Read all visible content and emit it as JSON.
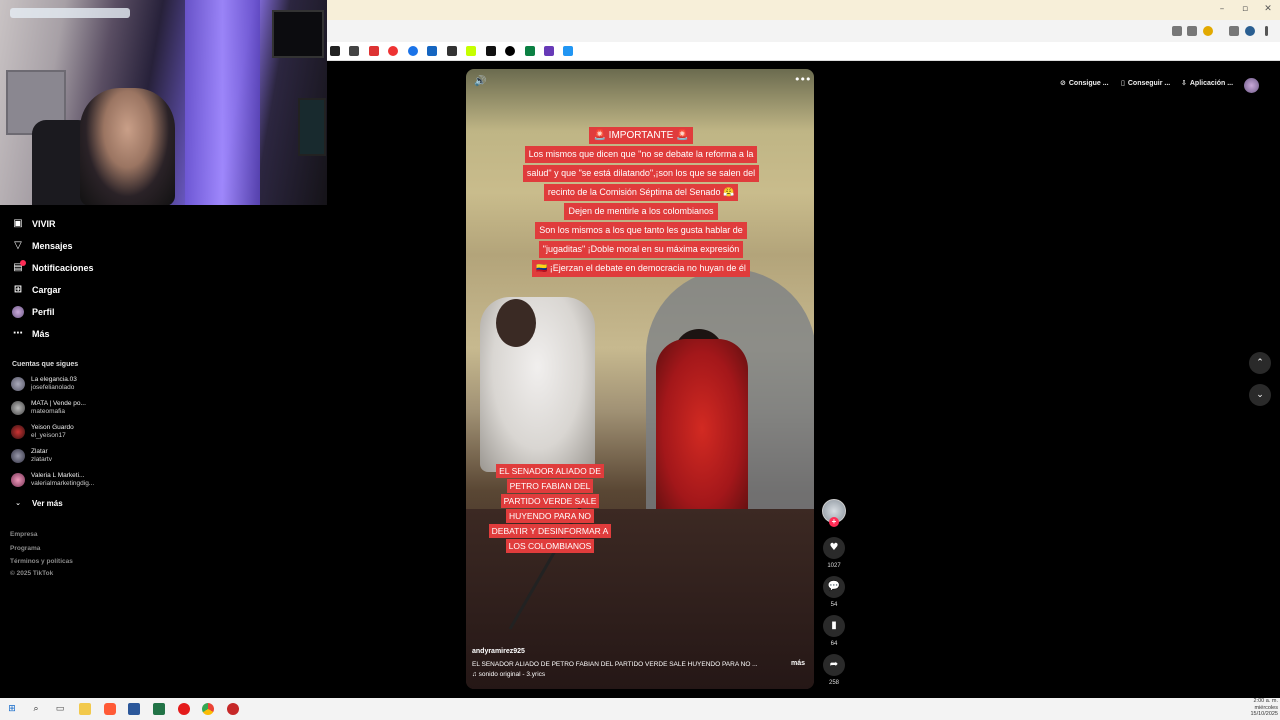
{
  "browser": {
    "window_controls": [
      "–",
      "▫",
      "✕"
    ]
  },
  "sidebar": {
    "nav": [
      {
        "label": "VIVIR",
        "icon": "live-icon"
      },
      {
        "label": "Mensajes",
        "icon": "messages-icon"
      },
      {
        "label": "Notificaciones",
        "icon": "notifications-icon"
      },
      {
        "label": "Cargar",
        "icon": "upload-icon"
      },
      {
        "label": "Perfil",
        "icon": "profile-icon"
      },
      {
        "label": "Más",
        "icon": "more-icon"
      }
    ],
    "following_title": "Cuentas que sigues",
    "following": [
      {
        "name": "La elegancia.03",
        "handle": "josefelianolado"
      },
      {
        "name": "MATA | Vende po...",
        "handle": "mateomafia"
      },
      {
        "name": "Yeison Guardo",
        "handle": "el_yeison17"
      },
      {
        "name": "Zlatar",
        "handle": "zlatartv"
      },
      {
        "name": "Valeria L Marketi...",
        "handle": "valerialmarketingdig..."
      }
    ],
    "see_more": "Ver más",
    "footer": [
      "Empresa",
      "Programa",
      "Términos y políticas",
      "© 2025 TikTok"
    ]
  },
  "header": {
    "buttons": [
      "Consigue ...",
      "Conseguir ...",
      "Aplicación ..."
    ]
  },
  "video": {
    "caption_top": [
      "🚨 IMPORTANTE 🚨",
      "Los mismos que dicen que \"no se debate la reforma a la",
      "salud\" y que \"se está dilatando\",¡son los que se salen del",
      "recinto de la Comisión Séptima del Senado 😤",
      "Dejen de mentirle a los colombianos",
      "Son los mismos a los que tanto les gusta hablar de",
      "\"jugaditas\" ¡Doble moral en su máxima expresión",
      "🇨🇴 ¡Ejerzan el debate en democracia no huyan de él"
    ],
    "caption_bottom": [
      "EL SENADOR ALIADO DE",
      "PETRO FABIAN DEL",
      "PARTIDO VERDE SALE",
      "HUYENDO PARA NO",
      "DEBATIR Y DESINFORMAR A",
      "LOS COLOMBIANOS"
    ],
    "author": "andyramirez925",
    "description": "EL SENADOR ALIADO DE PETRO FABIAN DEL PARTIDO VERDE SALE HUYENDO PARA NO ...",
    "more_label": "más",
    "sound": "♫ sonido original - 3.yrics"
  },
  "actions": {
    "likes": "1027",
    "comments": "54",
    "saves": "64",
    "shares": "258"
  },
  "taskbar": {
    "clock_time": "2:00 a. m.",
    "clock_day": "miércoles",
    "clock_date": "15/10/2025"
  }
}
